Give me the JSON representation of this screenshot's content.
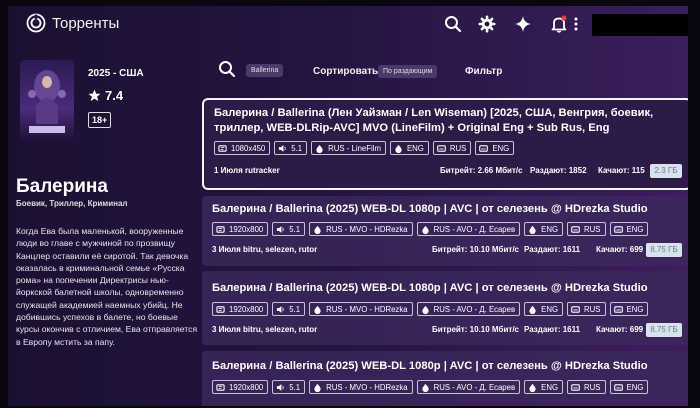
{
  "app": {
    "title": "Торренты"
  },
  "movie": {
    "year_country": "2025 - США",
    "rating": "7.4",
    "age": "18+",
    "title": "Балерина",
    "genres": "Боевик, Триллер, Криминал",
    "description": "Когда Ева была маленькой, вооруженные люди во главе с мужчиной по прозвищу Канцлер оставили её сиротой. Так девочка оказалась в криминальной семье «Русска рома» на попечении Директрисы нью-йоркской балетной школы, одновременно служащей академией наемных убийц. Не добившись успехов в балете, но боевые курсы окончив с отличием, Ева отправляется в Европу мстить за папу."
  },
  "filters": {
    "search_chip": "Ballerina",
    "sort_label": "Сортировать",
    "sort_chip": "По раздающим",
    "filter_label": "Фильтр"
  },
  "torrents": [
    {
      "title": "Балерина / Ballerina (Лен Уайзман / Len Wiseman) [2025, США, Венгрия, боевик, триллер, WEB-DLRip-AVC] MVO (LineFilm) + Original Eng + Sub Rus, Eng",
      "tags": [
        {
          "icon": "video-icon",
          "text": "1080x450"
        },
        {
          "icon": "speaker-icon",
          "text": "5.1"
        },
        {
          "icon": "audio-drop-icon",
          "text": "RUS - LineFilm"
        },
        {
          "icon": "audio-drop-icon",
          "text": "ENG"
        },
        {
          "icon": "subtitles-icon",
          "text": "RUS"
        },
        {
          "icon": "subtitles-icon",
          "text": "ENG"
        }
      ],
      "meta": "1 Июля   rutracker",
      "bitrate": "Битрейт: 2.66 Мбит/с",
      "seeders": "Раздают: 1852",
      "leechers": "Качают: 115",
      "size": "2.3 ГБ"
    },
    {
      "title": "Балерина / Ballerina (2025) WEB-DL 1080p | AVC | от селезень @ HDrezka Studio",
      "tags": [
        {
          "icon": "video-icon",
          "text": "1920x800"
        },
        {
          "icon": "speaker-icon",
          "text": "5.1"
        },
        {
          "icon": "audio-drop-icon",
          "text": "RUS - MVO - HDRezka"
        },
        {
          "icon": "audio-drop-icon",
          "text": "RUS - AVO - Д. Есарев"
        },
        {
          "icon": "audio-drop-icon",
          "text": "ENG"
        },
        {
          "icon": "subtitles-icon",
          "text": "RUS"
        },
        {
          "icon": "subtitles-icon",
          "text": "ENG"
        }
      ],
      "meta": "3 Июля   bitru, selezen, rutor",
      "bitrate": "Битрейт: 10.10 Мбит/с",
      "seeders": "Раздают: 1611",
      "leechers": "Качают: 699",
      "size": "8.75 ГБ"
    },
    {
      "title": "Балерина / Ballerina (2025) WEB-DL 1080p | AVC | от селезень @ HDrezka Studio",
      "tags": [
        {
          "icon": "video-icon",
          "text": "1920x800"
        },
        {
          "icon": "speaker-icon",
          "text": "5.1"
        },
        {
          "icon": "audio-drop-icon",
          "text": "RUS - MVO - HDRezka"
        },
        {
          "icon": "audio-drop-icon",
          "text": "RUS - AVO - Д. Есарев"
        },
        {
          "icon": "audio-drop-icon",
          "text": "ENG"
        },
        {
          "icon": "subtitles-icon",
          "text": "RUS"
        },
        {
          "icon": "subtitles-icon",
          "text": "ENG"
        }
      ],
      "meta": "3 Июля   bitru, selezen, rutor",
      "bitrate": "Битрейт: 10.10 Мбит/с",
      "seeders": "Раздают: 1611",
      "leechers": "Качают: 699",
      "size": "8.75 ГБ"
    },
    {
      "title": "Балерина / Ballerina (2025) WEB-DL 1080p | AVC | от селезень @ HDrezka Studio",
      "tags": [
        {
          "icon": "video-icon",
          "text": "1920x800"
        },
        {
          "icon": "speaker-icon",
          "text": "5.1"
        },
        {
          "icon": "audio-drop-icon",
          "text": "RUS - MVO - HDRezka"
        },
        {
          "icon": "audio-drop-icon",
          "text": "RUS - AVO - Д. Есарев"
        },
        {
          "icon": "audio-drop-icon",
          "text": "ENG"
        },
        {
          "icon": "subtitles-icon",
          "text": "RUS"
        },
        {
          "icon": "subtitles-icon",
          "text": "ENG"
        }
      ],
      "meta": "",
      "bitrate": "",
      "seeders": "",
      "leechers": "",
      "size": ""
    }
  ]
}
